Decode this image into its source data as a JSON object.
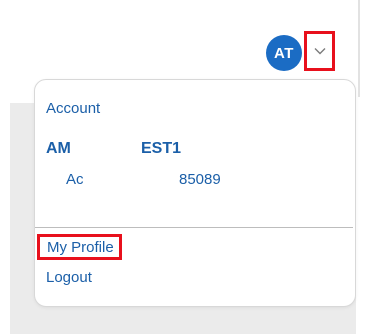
{
  "header": {
    "avatar_initials": "AT",
    "dropdown_icon": "chevron-down-icon",
    "avatar_color": "#1b6cc4",
    "highlight_color": "#e8101c"
  },
  "menu": {
    "section_label": "Account",
    "account_name_part1": "AM",
    "account_name_part2": "EST1",
    "account_number_part1": "Ac",
    "account_number_part2": "85089",
    "my_profile_label": "My Profile",
    "logout_label": "Logout",
    "link_color": "#1b5fa8"
  }
}
